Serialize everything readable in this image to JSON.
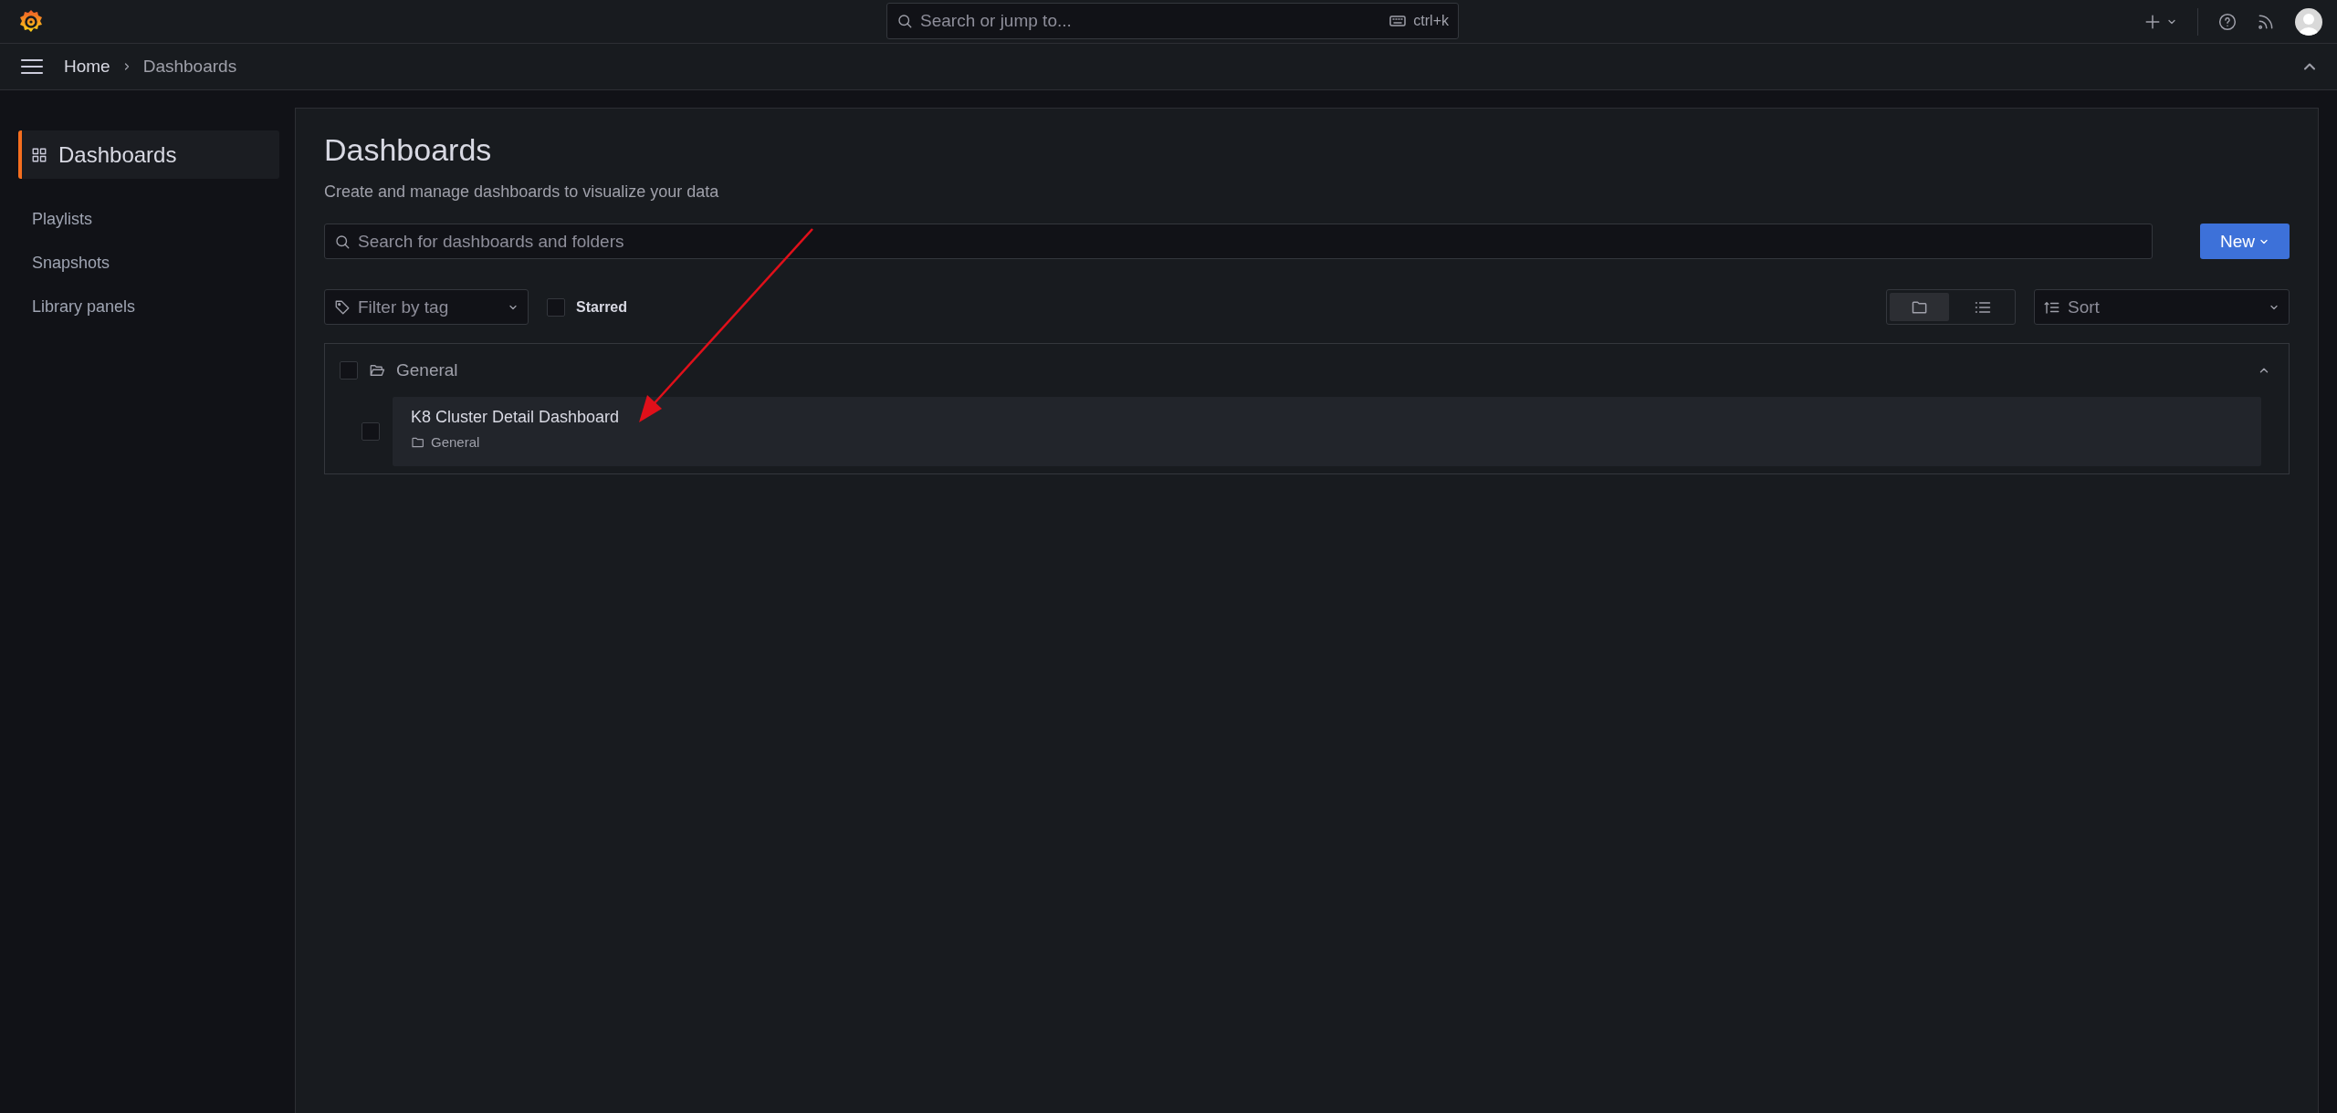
{
  "topbar": {
    "search": {
      "placeholder": "Search or jump to...",
      "shortcut": "ctrl+k"
    }
  },
  "breadcrumbs": [
    {
      "label": "Home",
      "selected": false
    },
    {
      "label": "Dashboards",
      "selected": true
    }
  ],
  "sidebar": {
    "items": [
      {
        "label": "Dashboards",
        "selected": true
      },
      {
        "label": "Playlists",
        "selected": false
      },
      {
        "label": "Snapshots",
        "selected": false
      },
      {
        "label": "Library panels",
        "selected": false
      }
    ]
  },
  "page": {
    "title": "Dashboards",
    "subtitle": "Create and manage dashboards to visualize your data",
    "search": {
      "placeholder": "Search for dashboards and folders"
    },
    "new_button": "New",
    "filter": {
      "placeholder": "Filter by tag"
    },
    "starred": {
      "label": "Starred",
      "checked": false
    },
    "view_modes": [
      {
        "kind": "folder",
        "selected": true
      },
      {
        "kind": "list",
        "selected": false
      }
    ],
    "sort": {
      "placeholder": "Sort"
    },
    "folders": [
      {
        "name": "General",
        "checked": false,
        "expanded": true,
        "dashboards": [
          {
            "title": "K8 Cluster Detail Dashboard",
            "folder": "General",
            "checked": false
          }
        ]
      }
    ]
  }
}
